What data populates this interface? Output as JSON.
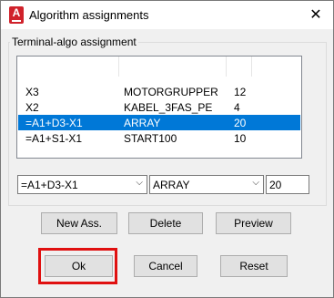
{
  "window": {
    "title": "Algorithm assignments",
    "app_icon_letter": "A"
  },
  "group": {
    "label": "Terminal-algo assignment"
  },
  "list": {
    "rows": [
      {
        "terminal": "X3",
        "algorithm": "MOTORGRUPPER",
        "value": "12",
        "selected": false
      },
      {
        "terminal": "X2",
        "algorithm": "KABEL_3FAS_PE",
        "value": "4",
        "selected": false
      },
      {
        "terminal": "=A1+D3-X1",
        "algorithm": "ARRAY",
        "value": "20",
        "selected": true
      },
      {
        "terminal": "=A1+S1-X1",
        "algorithm": "START100",
        "value": "10",
        "selected": false
      }
    ]
  },
  "editors": {
    "terminal_value": "=A1+D3-X1",
    "algorithm_value": "ARRAY",
    "number_value": "20"
  },
  "buttons": {
    "new_ass": "New Ass.",
    "delete": "Delete",
    "preview": "Preview",
    "ok": "Ok",
    "cancel": "Cancel",
    "reset": "Reset"
  },
  "icons": {
    "close": "close-icon",
    "dropdown": "chevron-down-icon"
  },
  "colors": {
    "selection": "#0078d7",
    "highlight": "#e01010",
    "app_icon": "#d0222b"
  }
}
